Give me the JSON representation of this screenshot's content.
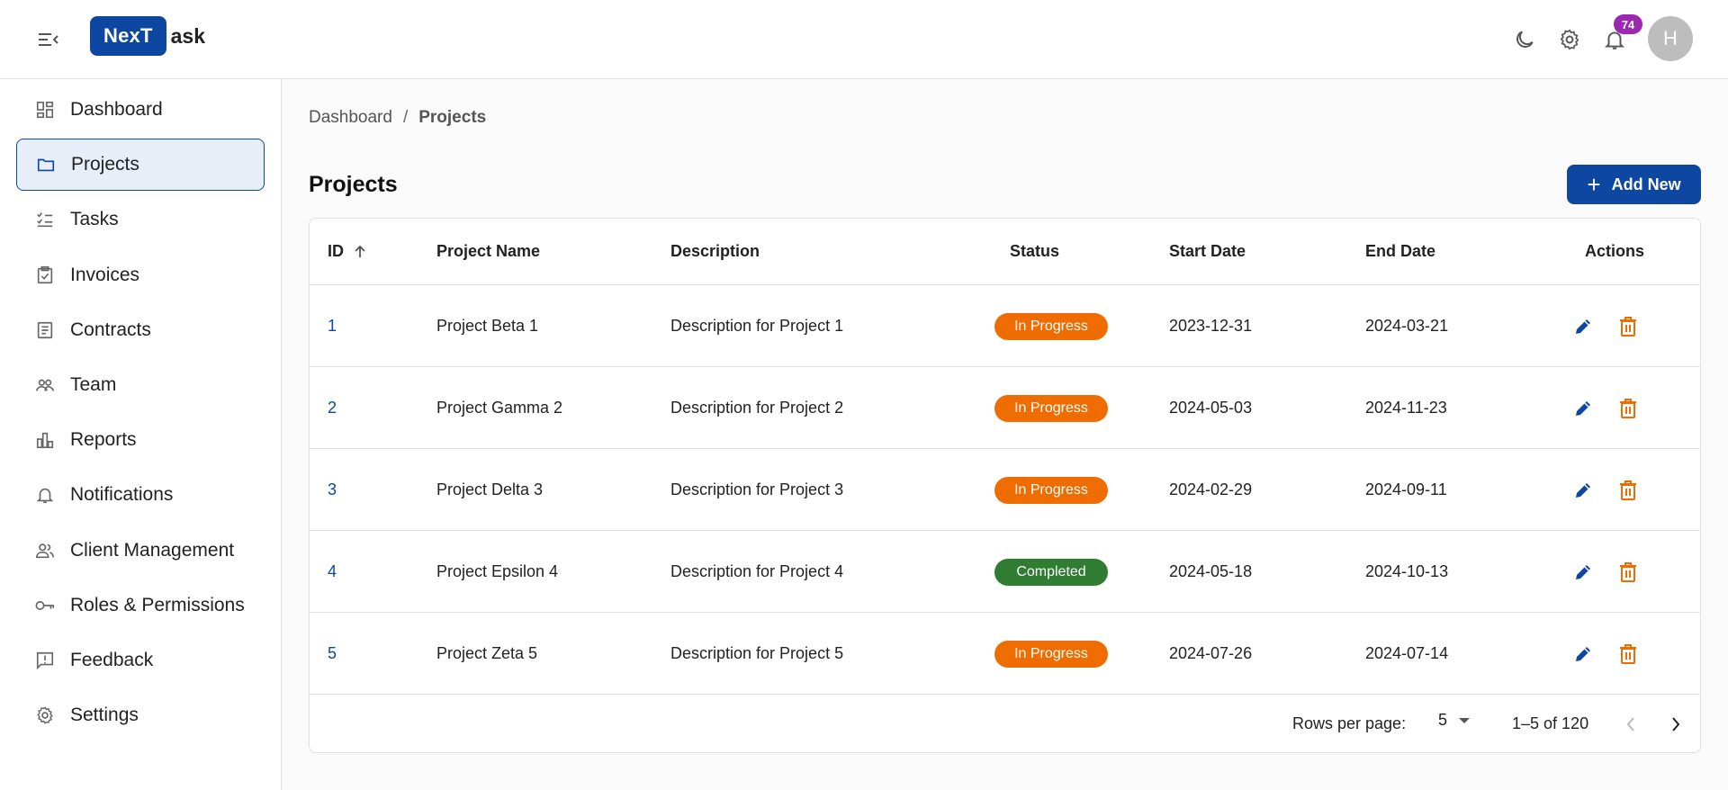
{
  "header": {
    "logo_box": "NexT",
    "logo_rest": "ask",
    "notifications_count": "74",
    "avatar_initial": "H"
  },
  "sidebar": {
    "items": [
      {
        "label": "Dashboard",
        "icon": "dashboard-icon"
      },
      {
        "label": "Projects",
        "icon": "folder-icon"
      },
      {
        "label": "Tasks",
        "icon": "checklist-icon"
      },
      {
        "label": "Invoices",
        "icon": "clipboard-check-icon"
      },
      {
        "label": "Contracts",
        "icon": "document-icon"
      },
      {
        "label": "Team",
        "icon": "people-icon"
      },
      {
        "label": "Reports",
        "icon": "bar-chart-icon"
      },
      {
        "label": "Notifications",
        "icon": "bell-icon"
      },
      {
        "label": "Client Management",
        "icon": "group-icon"
      },
      {
        "label": "Roles & Permissions",
        "icon": "key-icon"
      },
      {
        "label": "Feedback",
        "icon": "feedback-icon"
      },
      {
        "label": "Settings",
        "icon": "gear-icon"
      }
    ],
    "active_index": 1
  },
  "breadcrumb": {
    "root": "Dashboard",
    "sep": "/",
    "current": "Projects"
  },
  "page": {
    "title": "Projects",
    "add_label": "Add New"
  },
  "table": {
    "headers": [
      "ID",
      "Project Name",
      "Description",
      "Status",
      "Start Date",
      "End Date",
      "Actions"
    ],
    "rows": [
      {
        "id": "1",
        "name": "Project Beta 1",
        "description": "Description for Project 1",
        "status": "In Progress",
        "start": "2023-12-31",
        "end": "2024-03-21"
      },
      {
        "id": "2",
        "name": "Project Gamma 2",
        "description": "Description for Project 2",
        "status": "In Progress",
        "start": "2024-05-03",
        "end": "2024-11-23"
      },
      {
        "id": "3",
        "name": "Project Delta 3",
        "description": "Description for Project 3",
        "status": "In Progress",
        "start": "2024-02-29",
        "end": "2024-09-11"
      },
      {
        "id": "4",
        "name": "Project Epsilon 4",
        "description": "Description for Project 4",
        "status": "Completed",
        "start": "2024-05-18",
        "end": "2024-10-13"
      },
      {
        "id": "5",
        "name": "Project Zeta 5",
        "description": "Description for Project 5",
        "status": "In Progress",
        "start": "2024-07-26",
        "end": "2024-07-14"
      }
    ],
    "footer": {
      "rows_per_page_label": "Rows per page:",
      "rows_per_page": "5",
      "range": "1–5 of 120"
    }
  },
  "colors": {
    "brand": "#0d47a1",
    "in_progress": "#ef6c00",
    "completed": "#2e7d32",
    "badge": "#9c27b0",
    "delete": "#ef6c00"
  }
}
